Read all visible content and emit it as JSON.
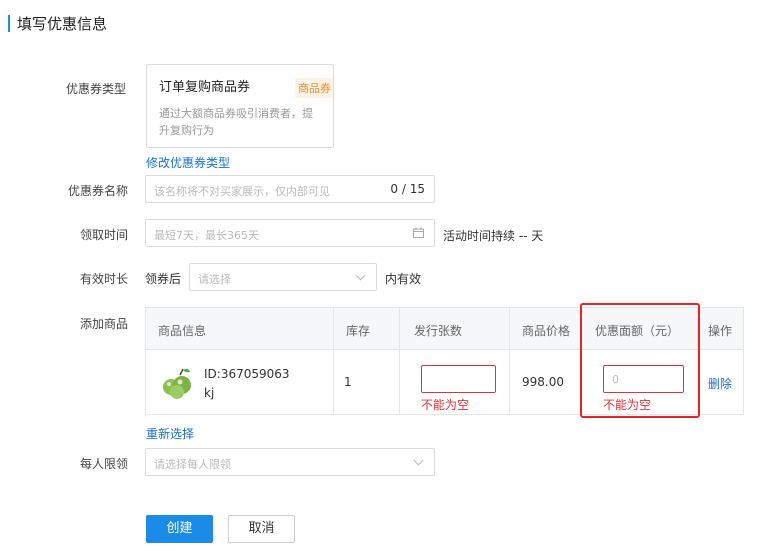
{
  "header": {
    "title": "填写优惠信息"
  },
  "form": {
    "type_label": "优惠券类型",
    "coupon_card": {
      "title": "订单复购商品券",
      "badge": "商品券",
      "description": "通过大额商品券吸引消费者，提升复购行为"
    },
    "change_type_link": "修改优惠券类型",
    "name_label": "优惠券名称",
    "name_placeholder": "该名称将不对买家展示，仅内部可见",
    "name_counter": "0 / 15",
    "time_label": "领取时间",
    "time_placeholder": "最短7天，最长365天",
    "time_duration_text": "活动时间持续 -- 天",
    "validity_label": "有效时长",
    "validity_prefix": "领券后",
    "validity_placeholder": "请选择",
    "validity_suffix": "内有效",
    "products_label": "添加商品",
    "reselect_link": "重新选择",
    "limit_label": "每人限领",
    "limit_placeholder": "请选择每人限领"
  },
  "table": {
    "headers": {
      "info": "商品信息",
      "stock": "库存",
      "issue_count": "发行张数",
      "price": "商品价格",
      "discount": "优惠面额（元）",
      "action": "操作"
    },
    "rows": [
      {
        "id_text": "ID:367059063",
        "name": "kj",
        "stock": "1",
        "issue_error": "不能为空",
        "price": "998.00",
        "discount_placeholder": "0",
        "discount_error": "不能为空",
        "action": "删除"
      }
    ]
  },
  "buttons": {
    "create": "创建",
    "cancel": "取消"
  },
  "colors": {
    "primary": "#1a8ce8",
    "error": "#e0343a",
    "highlight": "#e8242a",
    "link": "#1a73c9"
  }
}
